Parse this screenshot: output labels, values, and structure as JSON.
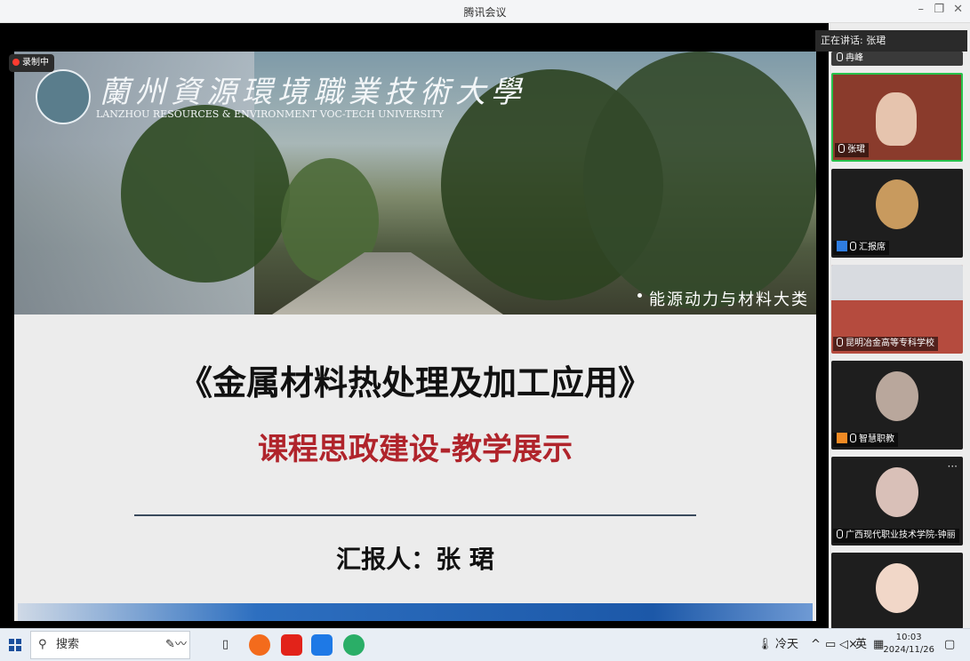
{
  "window": {
    "title": "腾讯会议",
    "minimize": "–",
    "restore": "❐",
    "close": "✕"
  },
  "recording": {
    "label": "录制中"
  },
  "speaking": {
    "label": "正在讲话:",
    "name": "张珺"
  },
  "slide": {
    "univ_cn": "蘭州資源環境職業技術大學",
    "univ_en": "LANZHOU RESOURCES & ENVIRONMENT VOC-TECH UNIVERSITY",
    "category": "能源动力与材料大类",
    "course_title": "《金属材料热处理及加工应用》",
    "subtitle": "课程思政建设-教学展示",
    "reporter": "汇报人：张 珺"
  },
  "participants": [
    {
      "name": "冉峰",
      "active": false
    },
    {
      "name": "张珺",
      "active": true
    },
    {
      "name": "汇报席",
      "active": false
    },
    {
      "name": "昆明冶金高等专科学校",
      "active": false
    },
    {
      "name": "智慧职教",
      "active": false
    },
    {
      "name": "广西现代职业技术学院-钟丽",
      "active": false
    },
    {
      "name": "",
      "active": false
    }
  ],
  "taskbar": {
    "start_icon": "windows-icon",
    "search_placeholder": "搜索",
    "weather": "冷天",
    "ime": "英",
    "time": "10:03",
    "date": "2024/11/26"
  },
  "colors": {
    "accent_green": "#27c24c",
    "title_red": "#b0242b",
    "bar_blue": "#1c58a8"
  }
}
